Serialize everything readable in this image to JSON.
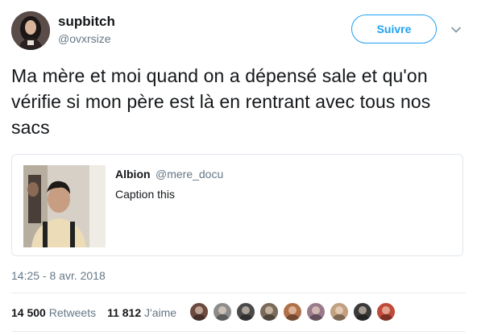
{
  "author": {
    "display_name": "supbitch",
    "handle": "@ovxrsize",
    "avatar_icon": "profile-photo"
  },
  "follow_button": {
    "label": "Suivre",
    "color": "#1da1f2"
  },
  "more_icon": "chevron-down-icon",
  "tweet": {
    "text": "Ma mère et moi quand on a dépensé sale et qu'on vérifie si mon père est là en rentrant avec tous nos sacs",
    "timestamp": "14:25 - 8 avr. 2018"
  },
  "quoted_tweet": {
    "display_name": "Albion",
    "handle": "@mere_docu",
    "text": "Caption this",
    "media_icon": "photo-thumbnail"
  },
  "stats": {
    "retweets_count": "14 500",
    "retweets_label": "Retweets",
    "likes_count": "11 812",
    "likes_label": "J'aime"
  },
  "likers": [
    {
      "icon": "liker-avatar-1",
      "color": "#6b4a3f"
    },
    {
      "icon": "liker-avatar-2",
      "color": "#8c8c8c"
    },
    {
      "icon": "liker-avatar-3",
      "color": "#4a4a4a"
    },
    {
      "icon": "liker-avatar-4",
      "color": "#7a6a5a"
    },
    {
      "icon": "liker-avatar-5",
      "color": "#b0704a"
    },
    {
      "icon": "liker-avatar-6",
      "color": "#9a7a8a"
    },
    {
      "icon": "liker-avatar-7",
      "color": "#c0a080"
    },
    {
      "icon": "liker-avatar-8",
      "color": "#3a3a3a"
    },
    {
      "icon": "liker-avatar-9",
      "color": "#c04a3a"
    }
  ]
}
